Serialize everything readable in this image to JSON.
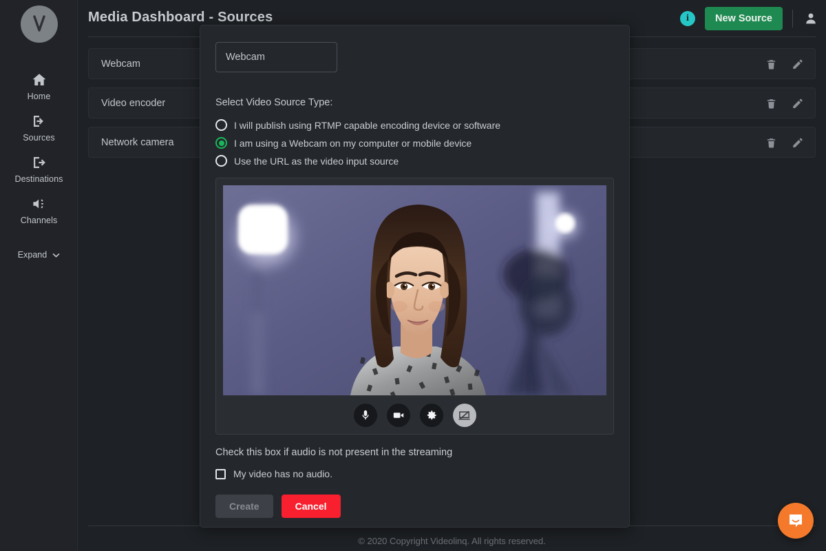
{
  "app": {
    "logo_letter": "V",
    "accent_green": "#1e8a51",
    "accent_cyan": "#26c6c6",
    "accent_red": "#f81f2e",
    "radio_selected_color": "#19b65b",
    "chat_color": "#f4792b"
  },
  "sidebar": {
    "items": [
      {
        "label": "Home",
        "icon": "home-icon"
      },
      {
        "label": "Sources",
        "icon": "sources-login-icon"
      },
      {
        "label": "Destinations",
        "icon": "destinations-logout-icon"
      },
      {
        "label": "Channels",
        "icon": "channels-speaker-icon"
      }
    ],
    "expand_label": "Expand"
  },
  "header": {
    "title": "Media Dashboard - Sources",
    "info_label": "i",
    "new_source_label": "New Source",
    "avatar_icon": "user-avatar-icon"
  },
  "sources": {
    "rows": [
      {
        "name": "Webcam",
        "delete_icon": "trash-icon",
        "edit_icon": "pencil-icon"
      },
      {
        "name": "Video encoder",
        "delete_icon": "trash-icon",
        "edit_icon": "pencil-icon"
      },
      {
        "name": "Network camera",
        "delete_icon": "trash-icon",
        "edit_icon": "pencil-icon"
      }
    ]
  },
  "modal": {
    "name_input": {
      "value": "Webcam",
      "placeholder": "Source name"
    },
    "section_label": "Select Video Source Type:",
    "options": [
      {
        "label": "I will publish using RTMP capable encoding device or software",
        "selected": false
      },
      {
        "label": "I am using a Webcam on my computer or mobile device",
        "selected": true
      },
      {
        "label": "Use the URL as the video input source",
        "selected": false
      }
    ],
    "preview": {
      "controls": [
        {
          "icon": "microphone-icon",
          "state": "on"
        },
        {
          "icon": "video-camera-icon",
          "state": "on"
        },
        {
          "icon": "gear-settings-icon",
          "state": "on"
        },
        {
          "icon": "screen-share-off-icon",
          "state": "off"
        }
      ]
    },
    "audio_hint": "Check this box if audio is not present in the streaming",
    "audio_checkbox": {
      "label": "My video has no audio.",
      "checked": false
    },
    "create_label": "Create",
    "cancel_label": "Cancel"
  },
  "footer": {
    "copyright": "© 2020 Copyright Videolinq. All rights reserved."
  },
  "chat": {
    "icon": "intercom-chat-icon"
  }
}
